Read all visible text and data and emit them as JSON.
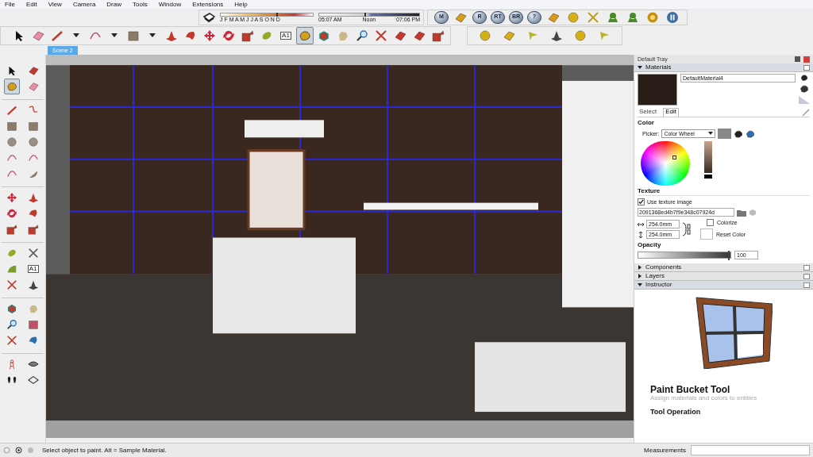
{
  "menu": [
    "File",
    "Edit",
    "View",
    "Camera",
    "Draw",
    "Tools",
    "Window",
    "Extensions",
    "Help"
  ],
  "shadow_settings": {
    "date": {
      "level": 0.6
    },
    "time": {
      "level": 0.45
    },
    "months": "J F M A M J J A S O N D",
    "start_time": "05:07 AM",
    "noon": "Noon",
    "end_time": "07:06 PM"
  },
  "plugin_toolbar": [
    {
      "kind": "letter",
      "label": "M"
    },
    {
      "kind": "tag"
    },
    {
      "kind": "letter",
      "label": "R"
    },
    {
      "kind": "letter",
      "label": "RT"
    },
    {
      "kind": "letter",
      "label": "BR"
    },
    {
      "kind": "letter",
      "label": "?"
    },
    {
      "kind": "tag"
    },
    {
      "kind": "sphere"
    },
    {
      "kind": "cross"
    },
    {
      "kind": "tree"
    },
    {
      "kind": "tree"
    },
    {
      "kind": "target"
    },
    {
      "kind": "pause"
    }
  ],
  "main_toolbar": [
    {
      "kind": "select",
      "selected": false
    },
    {
      "kind": "eraser",
      "selected": false
    },
    {
      "kind": "pencil",
      "selected": false
    },
    {
      "kind": "caret",
      "selected": false
    },
    {
      "kind": "arc",
      "selected": false
    },
    {
      "kind": "caret",
      "selected": false
    },
    {
      "kind": "rectangle",
      "selected": false
    },
    {
      "kind": "caret",
      "selected": false
    },
    {
      "kind": "pushpull",
      "selected": false
    },
    {
      "kind": "followme",
      "selected": false
    },
    {
      "kind": "move",
      "selected": false
    },
    {
      "kind": "rotate",
      "selected": false
    },
    {
      "kind": "scale",
      "selected": false
    },
    {
      "kind": "tape",
      "selected": false
    },
    {
      "kind": "text",
      "label": "A1",
      "selected": false
    },
    {
      "kind": "paint",
      "selected": true
    },
    {
      "kind": "orbit",
      "selected": false
    },
    {
      "kind": "pan",
      "selected": false
    },
    {
      "kind": "zoom",
      "selected": false
    },
    {
      "kind": "extents",
      "selected": false
    },
    {
      "kind": "box",
      "selected": false
    },
    {
      "kind": "box",
      "selected": false
    },
    {
      "kind": "export",
      "selected": false
    }
  ],
  "sandbox_toolbar": [
    {
      "kind": "sphere"
    },
    {
      "kind": "plane"
    },
    {
      "kind": "flag"
    },
    {
      "kind": "dome"
    },
    {
      "kind": "sphere"
    },
    {
      "kind": "flag"
    }
  ],
  "scene_tabs": [
    {
      "label": "Scene 2",
      "selected": true
    }
  ],
  "left_toolbar": [
    {
      "kind": "select",
      "selected": false
    },
    {
      "kind": "box",
      "selected": false
    },
    {
      "kind": "paint",
      "selected": true
    },
    {
      "kind": "eraser",
      "selected": false
    },
    {
      "kind": "pencil",
      "selected": false
    },
    {
      "kind": "freehand",
      "selected": false
    },
    {
      "kind": "rectangle",
      "selected": false
    },
    {
      "kind": "rectangle",
      "selected": false
    },
    {
      "kind": "circle",
      "selected": false
    },
    {
      "kind": "circle",
      "selected": false
    },
    {
      "kind": "arc",
      "selected": false
    },
    {
      "kind": "arc",
      "selected": false
    },
    {
      "kind": "arc",
      "selected": false
    },
    {
      "kind": "pie",
      "selected": false
    },
    {
      "kind": "move",
      "selected": false
    },
    {
      "kind": "pushpull",
      "selected": false
    },
    {
      "kind": "rotate",
      "selected": false
    },
    {
      "kind": "followme",
      "selected": false
    },
    {
      "kind": "scale",
      "selected": false
    },
    {
      "kind": "export",
      "selected": false
    },
    {
      "kind": "tape",
      "selected": false
    },
    {
      "kind": "dimension",
      "selected": false
    },
    {
      "kind": "protractor",
      "selected": false
    },
    {
      "kind": "text",
      "label": "A1",
      "selected": false
    },
    {
      "kind": "axes",
      "selected": false
    },
    {
      "kind": "dome",
      "selected": false
    },
    {
      "kind": "orbit",
      "selected": false
    },
    {
      "kind": "pan",
      "selected": false
    },
    {
      "kind": "zoom",
      "selected": false
    },
    {
      "kind": "zoomwindow",
      "selected": false
    },
    {
      "kind": "extents",
      "selected": false
    },
    {
      "kind": "previous",
      "selected": false
    },
    {
      "kind": "person",
      "selected": false
    },
    {
      "kind": "eye",
      "selected": false
    },
    {
      "kind": "feet",
      "selected": false
    },
    {
      "kind": "section",
      "selected": false
    }
  ],
  "tray": {
    "title": "Default Tray",
    "materials": {
      "title": "Materials",
      "expanded": true,
      "material_name": "DefaultMaterial4",
      "tabs": [
        {
          "label": "Select",
          "selected": false
        },
        {
          "label": "Edit",
          "selected": true
        }
      ],
      "color_heading": "Color",
      "picker_label": "Picker:",
      "picker_value": "Color Wheel",
      "texture_heading": "Texture",
      "use_texture": {
        "label": "Use texture image",
        "checked": true
      },
      "texture_file": "2091368ed4b7f9e348c07924d",
      "width": "254.0mm",
      "height": "254.0mm",
      "colorize": {
        "label": "Colorize",
        "checked": false
      },
      "reset_color": "Reset Color",
      "opacity_heading": "Opacity",
      "opacity": {
        "level": 0.97
      },
      "opacity_value": "100"
    },
    "panels": [
      {
        "title": "Components",
        "expanded": false
      },
      {
        "title": "Layers",
        "expanded": false
      },
      {
        "title": "Instructor",
        "expanded": true
      }
    ],
    "instructor": {
      "title": "Paint Bucket Tool",
      "description": "Assign materials and colors to entities",
      "section": "Tool Operation"
    }
  },
  "status_bar": {
    "message": "Select object to paint. Alt = Sample Material.",
    "measurements_label": "Measurements"
  }
}
